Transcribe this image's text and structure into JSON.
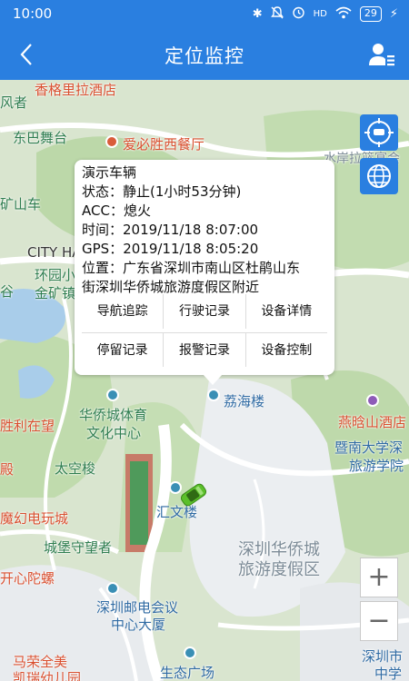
{
  "status_bar": {
    "time": "10:00",
    "battery": "29",
    "icons": [
      "bluetooth-icon",
      "mute-icon",
      "alarm-icon",
      "hd-icon",
      "wifi-icon",
      "battery-icon",
      "charging-icon"
    ]
  },
  "header": {
    "title": "定位监控",
    "back_icon": "chevron-left-icon",
    "user_icon": "user-list-icon"
  },
  "popup": {
    "vehicle_name": "演示车辆",
    "status_label": "状态：",
    "status_value": "静止(1小时53分钟)",
    "acc_label": "ACC：",
    "acc_value": "熄火",
    "time_label": "时间：",
    "time_value": "2019/11/18 8:07:00",
    "gps_label": "GPS：",
    "gps_value": "2019/11/18 8:05:20",
    "location_label": "位置：",
    "location_value_line1": "广东省深圳市南山区杜鹃山东",
    "location_value_line2": "街深圳华侨城旅游度假区附近",
    "actions": [
      {
        "label": "导航追踪"
      },
      {
        "label": "行驶记录"
      },
      {
        "label": "设备详情"
      },
      {
        "label": "停留记录"
      },
      {
        "label": "报警记录"
      },
      {
        "label": "设备控制"
      }
    ]
  },
  "map": {
    "labels": {
      "xiangge": "香格里拉酒店",
      "fengzhe": "风者",
      "dongba": "东巴舞台",
      "aibisheng": "爱必胜西餐厅",
      "shuian": "水岸拉篮宴会",
      "kuangshan": "矿山车",
      "cityhall": "CITY HA",
      "huanyuan": "环园小",
      "jinkuang": "金矿镇",
      "gu": "谷",
      "shengli": "胜利在望",
      "tiyu1": "华侨城体育",
      "tiyu2": "文化中心",
      "taikong": "太空梭",
      "dian": "殿",
      "mohuan": "魔幻电玩城",
      "chengbao": "城堡守望者",
      "tuoluo": "开心陀螺",
      "lihai": "荔海楼",
      "yanhan": "燕晗山酒店",
      "jinan1": "暨南大学深",
      "jinan2": "旅游学院",
      "huiwen": "汇文楼",
      "resort1": "深圳华侨城",
      "resort2": "旅游度假区",
      "youdian1": "深圳邮电会议",
      "youdian2": "中心大厦",
      "mrong1": "马荣全美",
      "mrong2": "凯瑞幼儿园",
      "shengtai": "生态广场",
      "shenzhen1": "深圳市",
      "shenzhen2": "中学"
    },
    "controls": {
      "recenter_icon": "target-car-icon",
      "layer_icon": "globe-icon",
      "zoom_in": "+",
      "zoom_out": "−"
    }
  },
  "colors": {
    "primary": "#2a7fe0",
    "map_green": "#b8d7a6",
    "map_road": "#ffffff",
    "map_gray": "#e9ecef",
    "water": "#a9cdea",
    "car": "#5bbf2a"
  }
}
